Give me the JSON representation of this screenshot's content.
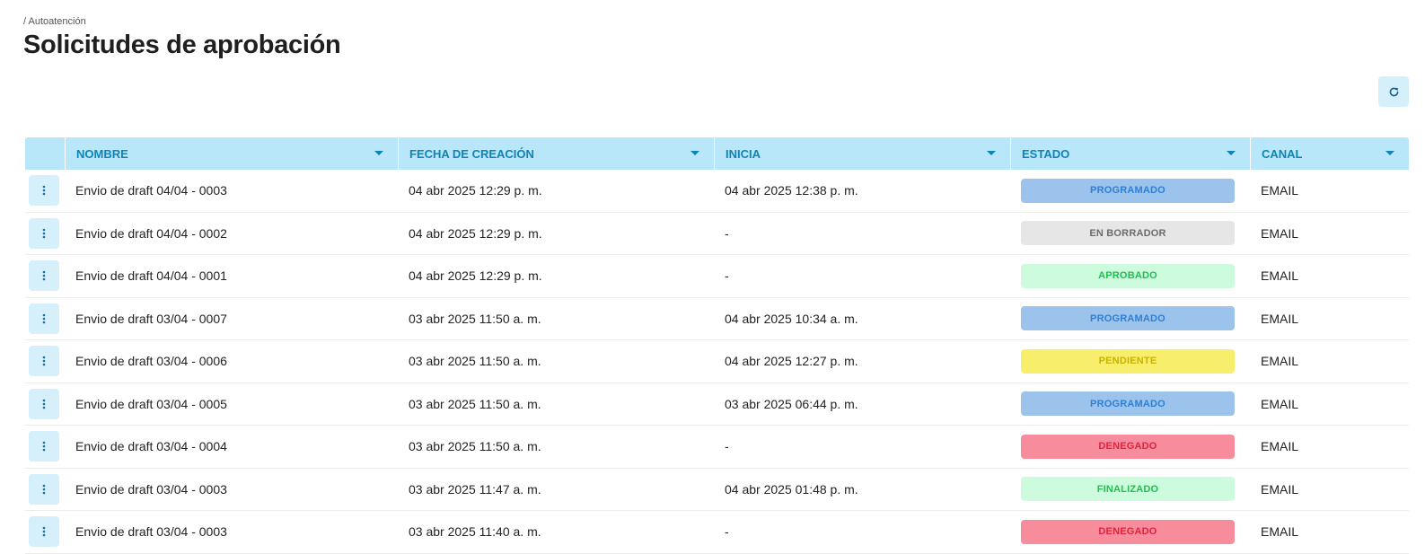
{
  "breadcrumb": "/ Autoatención",
  "title": "Solicitudes de aprobación",
  "toolbar": {
    "refresh_icon": "refresh-icon"
  },
  "columns": [
    "NOMBRE",
    "FECHA DE CREACIÓN",
    "INICIA",
    "ESTADO",
    "CANAL"
  ],
  "status_colors": {
    "PROGRAMADO": {
      "bg": "#9cc3ec",
      "fg": "#2f7fd3"
    },
    "EN BORRADOR": {
      "bg": "#e6e6e6",
      "fg": "#6b6b6b"
    },
    "APROBADO": {
      "bg": "#ccfbdd",
      "fg": "#1fbf4f"
    },
    "PENDIENTE": {
      "bg": "#f7ee6b",
      "fg": "#c9b300"
    },
    "DENEGADO": {
      "bg": "#f78c9c",
      "fg": "#e0233f"
    },
    "FINALIZADO": {
      "bg": "#ccfbdd",
      "fg": "#1fbf4f"
    }
  },
  "rows": [
    {
      "nombre": "Envio de draft 04/04 - 0003",
      "fecha": "04 abr 2025 12:29 p. m.",
      "inicia": "04 abr 2025 12:38 p. m.",
      "estado": "PROGRAMADO",
      "canal": "EMAIL"
    },
    {
      "nombre": "Envio de draft 04/04 - 0002",
      "fecha": "04 abr 2025 12:29 p. m.",
      "inicia": "-",
      "estado": "EN BORRADOR",
      "canal": "EMAIL"
    },
    {
      "nombre": "Envio de draft 04/04 - 0001",
      "fecha": "04 abr 2025 12:29 p. m.",
      "inicia": "-",
      "estado": "APROBADO",
      "canal": "EMAIL"
    },
    {
      "nombre": "Envio de draft 03/04 - 0007",
      "fecha": "03 abr 2025 11:50 a. m.",
      "inicia": "04 abr 2025 10:34 a. m.",
      "estado": "PROGRAMADO",
      "canal": "EMAIL"
    },
    {
      "nombre": "Envio de draft 03/04 - 0006",
      "fecha": "03 abr 2025 11:50 a. m.",
      "inicia": "04 abr 2025 12:27 p. m.",
      "estado": "PENDIENTE",
      "canal": "EMAIL"
    },
    {
      "nombre": "Envio de draft 03/04 - 0005",
      "fecha": "03 abr 2025 11:50 a. m.",
      "inicia": "03 abr 2025 06:44 p. m.",
      "estado": "PROGRAMADO",
      "canal": "EMAIL"
    },
    {
      "nombre": "Envio de draft 03/04 - 0004",
      "fecha": "03 abr 2025 11:50 a. m.",
      "inicia": "-",
      "estado": "DENEGADO",
      "canal": "EMAIL"
    },
    {
      "nombre": "Envio de draft 03/04 - 0003",
      "fecha": "03 abr 2025 11:47 a. m.",
      "inicia": "04 abr 2025 01:48 p. m.",
      "estado": "FINALIZADO",
      "canal": "EMAIL"
    },
    {
      "nombre": "Envio de draft 03/04 - 0003",
      "fecha": "03 abr 2025 11:40 a. m.",
      "inicia": "-",
      "estado": "DENEGADO",
      "canal": "EMAIL"
    }
  ]
}
